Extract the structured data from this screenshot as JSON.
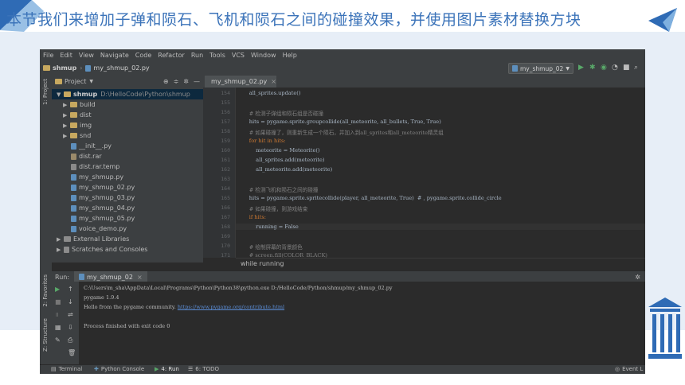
{
  "slide": {
    "title": "本节我们来增加子弹和陨石、飞机和陨石之间的碰撞效果，并使用图片素材替换方块",
    "accent_color": "#3b73b9"
  },
  "ide": {
    "menu": [
      "File",
      "Edit",
      "View",
      "Navigate",
      "Code",
      "Refactor",
      "Run",
      "Tools",
      "VCS",
      "Window",
      "Help"
    ],
    "nav": {
      "project": "shmup",
      "file": "my_shmup_02.py"
    },
    "run_config": "my_shmup_02",
    "sidebar_tabs": {
      "project": "1: Project",
      "favorites": "2: Favorites",
      "structure": "Z: Structure"
    },
    "project_panel": {
      "title": "Project",
      "root": {
        "name": "shmup",
        "path": "D:\\HelloCode\\Python\\shmup"
      },
      "folders": [
        "build",
        "dist",
        "img",
        "snd"
      ],
      "files": [
        "__init__.py",
        "dist.rar",
        "dist.rar.temp",
        "my_shmup.py",
        "my_shmup_02.py",
        "my_shmup_03.py",
        "my_shmup_04.py",
        "my_shmup_05.py",
        "voice_demo.py"
      ],
      "external": "External Libraries",
      "scratches": "Scratches and Consoles"
    },
    "editor": {
      "tab_label": "my_shmup_02.py",
      "line_numbers": [
        "154",
        "155",
        "156",
        "157",
        "158",
        "159",
        "160",
        "161",
        "162",
        "163",
        "164",
        "165",
        "166",
        "167",
        "168",
        "169",
        "170",
        "171"
      ],
      "lines": [
        "        all_sprites.update()",
        "",
        "        # 检测子弹组和陨石组是否碰撞",
        "        hits = pygame.sprite.groupcollide(all_meteorite, all_bullets, True, True)",
        "        # 如果碰撞了，则重新生成一个陨石，并加入到all_sprites和all_meteorite精灵组",
        "        for hit in hits:",
        "            meteorite = Meteorite()",
        "            all_sprites.add(meteorite)",
        "            all_meteorite.add(meteorite)",
        "",
        "        # 检测飞机和陨石之间的碰撞",
        "        hits = pygame.sprite.spritecollide(player, all_meteorite, True)  # , pygame.sprite.collide_circle",
        "        # 如果碰撞，则游戏结束",
        "        if hits:",
        "            running = False",
        "",
        "        # 绘制屏幕的背景颜色",
        "        # screen.fill(COLOR_BLACK)"
      ],
      "breadcrumb": "while running"
    },
    "run": {
      "label": "Run:",
      "tab": "my_shmup_02",
      "console": [
        "C:\\Users\\m_sha\\AppData\\Local\\Programs\\Python\\Python38\\python.exe D:/HelloCode/Python/shmup/my_shmup_02.py",
        "pygame 1.9.4",
        "Hello from the pygame community. ",
        "",
        "Process finished with exit code 0"
      ],
      "console_link": "https://www.pygame.org/contribute.html"
    },
    "status": {
      "terminal": "Terminal",
      "python_console": "Python Console",
      "run": "4: Run",
      "todo": "6: TODO",
      "event_log": "Event L"
    }
  }
}
